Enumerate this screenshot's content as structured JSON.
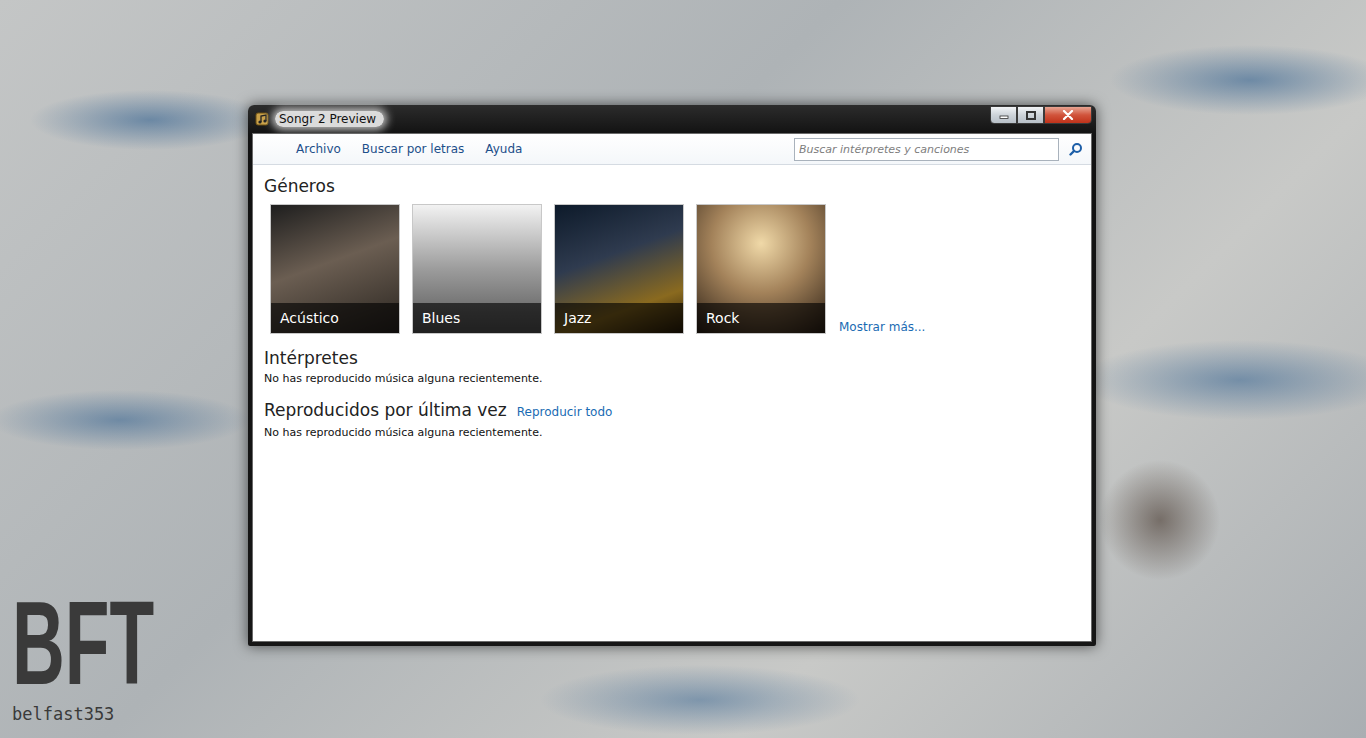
{
  "window": {
    "title": "Songr 2 Preview"
  },
  "menu": [
    {
      "label": "Archivo"
    },
    {
      "label": "Buscar por letras"
    },
    {
      "label": "Ayuda"
    }
  ],
  "search": {
    "placeholder": "Buscar intérpretes y canciones"
  },
  "genres": {
    "title": "Géneros",
    "items": [
      {
        "label": "Acústico"
      },
      {
        "label": "Blues"
      },
      {
        "label": "Jazz"
      },
      {
        "label": "Rock"
      }
    ],
    "more": "Mostrar más..."
  },
  "artists": {
    "title": "Intérpretes",
    "empty": "No has reproducido música alguna recientemente."
  },
  "recent": {
    "title": "Reproducidos por última vez",
    "action": "Reproducir todo",
    "empty": "No has reproducido música alguna recientemente."
  },
  "watermark": {
    "logo": "BFT",
    "name": "belfast353"
  }
}
